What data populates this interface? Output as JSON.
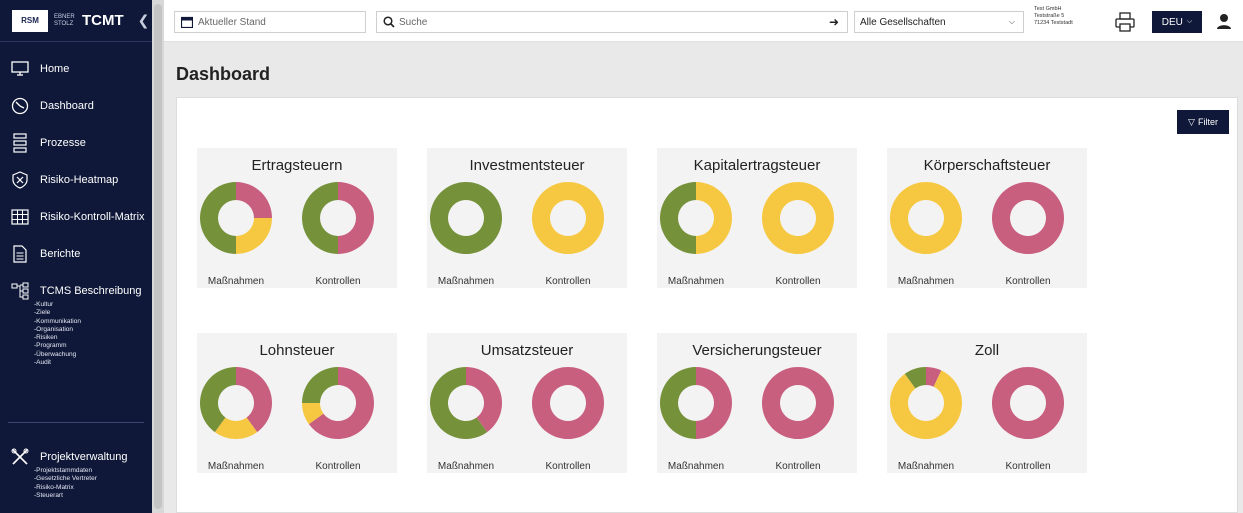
{
  "sidebar": {
    "logo_text": "RSM",
    "logo_sub": "EBNER STOLZ",
    "app_title": "TCMT",
    "collapse_icon": "chevron-left-icon",
    "items": [
      {
        "label": "Home",
        "icon": "monitor-icon"
      },
      {
        "label": "Dashboard",
        "icon": "gauge-icon"
      },
      {
        "label": "Prozesse",
        "icon": "process-icon"
      },
      {
        "label": "Risiko-Heatmap",
        "icon": "shield-x-icon"
      },
      {
        "label": "Risiko-Kontroll-Matrix",
        "icon": "grid-icon"
      },
      {
        "label": "Berichte",
        "icon": "document-icon"
      },
      {
        "label": "TCMS Beschreibung",
        "icon": "hierarchy-icon"
      }
    ],
    "tcms_subitems": [
      "-Kultur",
      "-Ziele",
      "-Kommunikation",
      "-Organisation",
      "-Risiken",
      "-Programm",
      "-Überwachung",
      "-Audit"
    ],
    "projekt": {
      "label": "Projektverwaltung",
      "icon": "tools-icon",
      "subitems": [
        "-Projektstammdaten",
        "-Gesetzliche Vertreter",
        "-Risiko-Matrix",
        "-Steuerart"
      ]
    }
  },
  "topbar": {
    "status_placeholder": "Aktueller Stand",
    "search_placeholder": "Suche",
    "company_select": "Alle Gesellschaften",
    "address": [
      "Test GmbH",
      "Teststraße 5",
      "71234 Teststadt"
    ],
    "language": "DEU"
  },
  "main": {
    "page_title": "Dashboard",
    "filter_label": "Filter"
  },
  "colors": {
    "green": "#75913a",
    "yellow": "#f6c842",
    "pink": "#c95f7f",
    "sidebar_bg": "#0f1838"
  },
  "cards": [
    {
      "title": "Ertragsteuern",
      "charts": [
        {
          "label": "Maßnahmen",
          "green": 0.5,
          "yellow": 0.25,
          "pink": 0.25
        },
        {
          "label": "Kontrollen",
          "green": 0.5,
          "yellow": 0,
          "pink": 0.5
        }
      ]
    },
    {
      "title": "Investmentsteuer",
      "charts": [
        {
          "label": "Maßnahmen",
          "green": 1,
          "yellow": 0,
          "pink": 0
        },
        {
          "label": "Kontrollen",
          "green": 0,
          "yellow": 1,
          "pink": 0
        }
      ]
    },
    {
      "title": "Kapitalertragsteuer",
      "charts": [
        {
          "label": "Maßnahmen",
          "green": 0.5,
          "yellow": 0.5,
          "pink": 0
        },
        {
          "label": "Kontrollen",
          "green": 0,
          "yellow": 1,
          "pink": 0
        }
      ]
    },
    {
      "title": "Körperschaftsteuer",
      "charts": [
        {
          "label": "Maßnahmen",
          "green": 0,
          "yellow": 1,
          "pink": 0
        },
        {
          "label": "Kontrollen",
          "green": 0,
          "yellow": 0,
          "pink": 1
        }
      ]
    },
    {
      "title": "Lohnsteuer",
      "charts": [
        {
          "label": "Maßnahmen",
          "green": 0.4,
          "yellow": 0.2,
          "pink": 0.4
        },
        {
          "label": "Kontrollen",
          "green": 0.25,
          "yellow": 0.1,
          "pink": 0.65
        }
      ]
    },
    {
      "title": "Umsatzsteuer",
      "charts": [
        {
          "label": "Maßnahmen",
          "green": 0.6,
          "yellow": 0,
          "pink": 0.4
        },
        {
          "label": "Kontrollen",
          "green": 0,
          "yellow": 0,
          "pink": 1
        }
      ]
    },
    {
      "title": "Versicherungsteuer",
      "charts": [
        {
          "label": "Maßnahmen",
          "green": 0.5,
          "yellow": 0,
          "pink": 0.5
        },
        {
          "label": "Kontrollen",
          "green": 0,
          "yellow": 0,
          "pink": 1
        }
      ]
    },
    {
      "title": "Zoll",
      "charts": [
        {
          "label": "Maßnahmen",
          "green": 0.1,
          "yellow": 0.83,
          "pink": 0.07
        },
        {
          "label": "Kontrollen",
          "green": 0,
          "yellow": 0,
          "pink": 1
        }
      ]
    }
  ]
}
